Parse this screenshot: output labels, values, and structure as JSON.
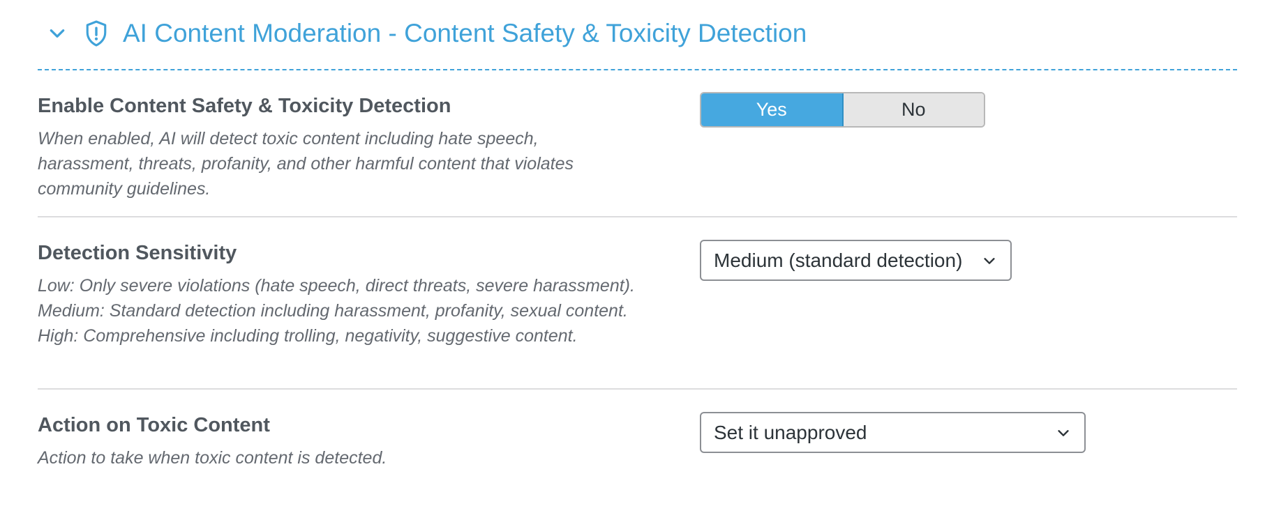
{
  "section": {
    "title": "AI Content Moderation - Content Safety & Toxicity Detection",
    "collapse_icon": "chevron-down-icon",
    "section_icon": "shield-alert-icon",
    "accent_color": "#3fa2d9"
  },
  "settings": {
    "enable": {
      "label": "Enable Content Safety & Toxicity Detection",
      "description": "When enabled, AI will detect toxic content including hate speech, harassment, threats, profanity, and other harmful content that violates community guidelines.",
      "options": [
        "Yes",
        "No"
      ],
      "selected": "Yes"
    },
    "sensitivity": {
      "label": "Detection Sensitivity",
      "description": "Low: Only severe violations (hate speech, direct threats, severe harassment). Medium: Standard detection including harassment, profanity, sexual content. High: Comprehensive including trolling, negativity, suggestive content.",
      "selected": "Medium (standard detection)"
    },
    "action": {
      "label": "Action on Toxic Content",
      "description": "Action to take when toxic content is detected.",
      "selected": "Set it unapproved"
    }
  }
}
